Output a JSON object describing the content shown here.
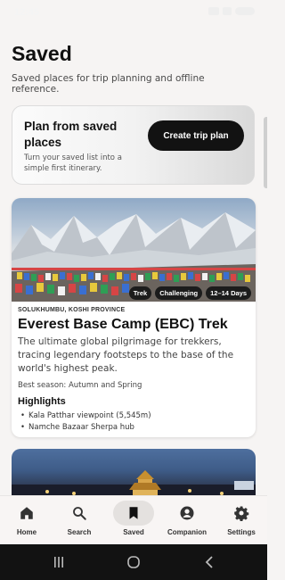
{
  "status_bar": {
    "time": "12:45"
  },
  "header": {
    "title": "Saved",
    "subtitle": "Saved places for trip planning and offline reference."
  },
  "plan_card": {
    "title": "Plan from saved places",
    "text": "Turn your saved list into a simple first itinerary.",
    "button_label": "Create trip plan"
  },
  "trek": {
    "tags": [
      "Trek",
      "Challenging",
      "12–14 Days"
    ],
    "region": "SOLUKHUMBU, KOSHI PROVINCE",
    "title": "Everest Base Camp (EBC) Trek",
    "description": "The ultimate global pilgrimage for trekkers, tracing legendary footsteps to the base of the world's highest peak.",
    "season": "Best season: Autumn and Spring",
    "highlights_heading": "Highlights",
    "highlights": [
      "Kala Patthar viewpoint (5,545m)",
      "Namche Bazaar Sherpa hub"
    ]
  },
  "nav": {
    "active": "Saved",
    "items": [
      {
        "label": "Home",
        "icon": "home-icon"
      },
      {
        "label": "Search",
        "icon": "search-icon"
      },
      {
        "label": "Saved",
        "icon": "bookmark-icon"
      },
      {
        "label": "Companion",
        "icon": "person-icon"
      },
      {
        "label": "Settings",
        "icon": "gear-icon"
      }
    ]
  },
  "colors": {
    "accent": "#121212",
    "background": "#f6f4f3",
    "active_pill": "#e4e1df"
  }
}
